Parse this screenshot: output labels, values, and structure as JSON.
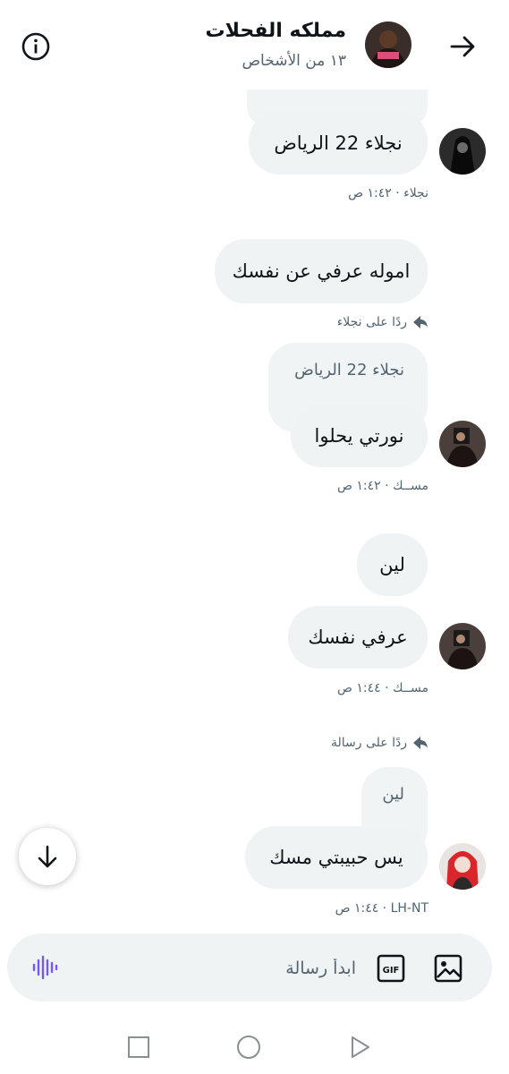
{
  "header": {
    "group_name": "مملكه الفحلات",
    "participants": "١٣ من الأشخاص",
    "back_icon": "arrow-right-icon",
    "info_icon": "info-icon"
  },
  "messages": [
    {
      "sender_meta": "نجلاء · ١:٤٢ ص",
      "text": "نجلاء 22 الرياض"
    },
    {
      "text": "اموله عرفي عن نفسك",
      "reply_label": "ردًا على نجلاء"
    },
    {
      "quote": "نجلاء 22 الرياض",
      "text": "نورتي يحلوا",
      "sender_meta": "مســك · ١:٤٢ ص"
    },
    {
      "text": "لين"
    },
    {
      "text": "عرفي نفسك",
      "sender_meta": "مســك · ١:٤٤ ص",
      "reply_label": "ردًا على رسالة"
    },
    {
      "quote": "لين",
      "text": "يس حبيبتي مسك",
      "sender_meta": "LH-NT · ١:٤٤ ص"
    }
  ],
  "composer": {
    "placeholder": "ابدأ رسالة",
    "gif_label": "GIF"
  },
  "colors": {
    "bubble": "#eff3f4",
    "meta": "#536471",
    "voice": "#7856ff"
  }
}
